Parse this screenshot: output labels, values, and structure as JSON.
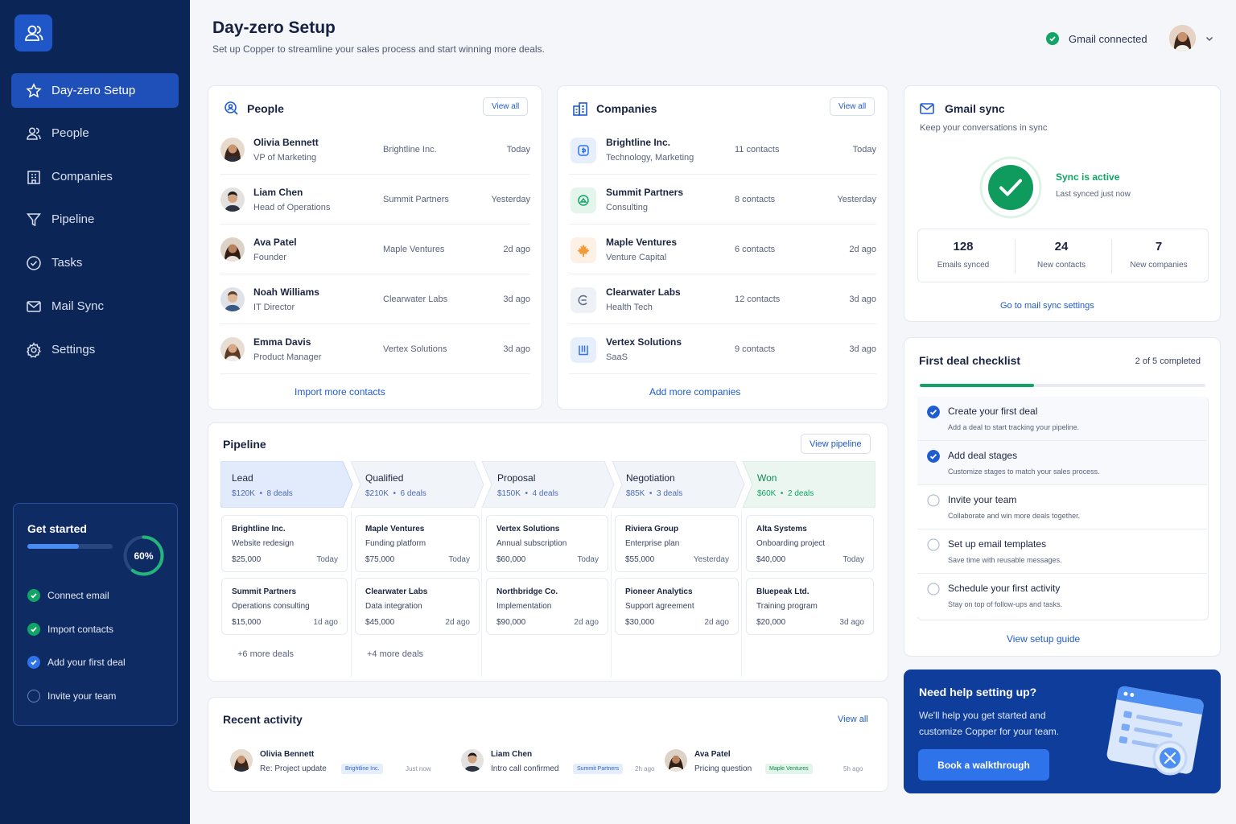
{
  "colors": {
    "sidebar": "#0c2557",
    "accent": "#1f5ccf",
    "success": "#12a464",
    "active_nav": "#1f4fb8"
  },
  "sidebar": {
    "items": [
      {
        "label": "Day-zero Setup",
        "icon": "rocket-icon",
        "active": true
      },
      {
        "label": "People",
        "icon": "people-icon"
      },
      {
        "label": "Companies",
        "icon": "building-icon"
      },
      {
        "label": "Pipeline",
        "icon": "funnel-icon"
      },
      {
        "label": "Tasks",
        "icon": "check-circle-icon"
      },
      {
        "label": "Mail Sync",
        "icon": "mail-icon"
      },
      {
        "label": "Settings",
        "icon": "gear-icon"
      }
    ],
    "get_started": {
      "title": "Get started",
      "progress_percent": 60,
      "progress_label": "60%",
      "items": [
        {
          "label": "Connect email",
          "state": "done"
        },
        {
          "label": "Import contacts",
          "state": "done"
        },
        {
          "label": "Add your first deal",
          "state": "current"
        },
        {
          "label": "Invite your team",
          "state": "todo"
        }
      ]
    }
  },
  "header": {
    "title": "Day-zero Setup",
    "subtitle": "Set up Copper to streamline your sales process and start winning more deals.",
    "gmail_status": "Gmail connected"
  },
  "people": {
    "title": "People",
    "view_all": "View all",
    "rows": [
      {
        "name": "Olivia Bennett",
        "role": "VP of Marketing",
        "company": "Brightline Inc.",
        "time": "Today"
      },
      {
        "name": "Liam Chen",
        "role": "Head of Operations",
        "company": "Summit Partners",
        "time": "Yesterday"
      },
      {
        "name": "Ava Patel",
        "role": "Founder",
        "company": "Maple Ventures",
        "time": "2d ago"
      },
      {
        "name": "Noah Williams",
        "role": "IT Director",
        "company": "Clearwater Labs",
        "time": "3d ago"
      },
      {
        "name": "Emma Davis",
        "role": "Product Manager",
        "company": "Vertex Solutions",
        "time": "3d ago"
      }
    ],
    "footer_link": "Import more contacts"
  },
  "companies": {
    "title": "Companies",
    "view_all": "View all",
    "rows": [
      {
        "name": "Brightline Inc.",
        "industry": "Technology, Marketing",
        "contacts": "11 contacts",
        "time": "Today"
      },
      {
        "name": "Summit Partners",
        "industry": "Consulting",
        "contacts": "8 contacts",
        "time": "Yesterday"
      },
      {
        "name": "Maple Ventures",
        "industry": "Venture Capital",
        "contacts": "6 contacts",
        "time": "2d ago"
      },
      {
        "name": "Clearwater Labs",
        "industry": "Health Tech",
        "contacts": "12 contacts",
        "time": "3d ago"
      },
      {
        "name": "Vertex Solutions",
        "industry": "SaaS",
        "contacts": "9 contacts",
        "time": "3d ago"
      }
    ],
    "footer_link": "Add more companies"
  },
  "gmail_sync": {
    "title": "Gmail sync",
    "subtitle": "Keep your conversations in sync",
    "status": "Sync is active",
    "last_synced": "Last synced just now",
    "stats": [
      {
        "value": "128",
        "label": "Emails synced"
      },
      {
        "value": "24",
        "label": "New contacts"
      },
      {
        "value": "7",
        "label": "New companies"
      }
    ],
    "settings_link": "Go to mail sync settings"
  },
  "pipeline": {
    "title": "Pipeline",
    "view_button": "View pipeline",
    "stages": [
      {
        "name": "Lead",
        "value": "$120K",
        "deals": "8 deals"
      },
      {
        "name": "Qualified",
        "value": "$210K",
        "deals": "6 deals"
      },
      {
        "name": "Proposal",
        "value": "$150K",
        "deals": "4 deals"
      },
      {
        "name": "Negotiation",
        "value": "$85K",
        "deals": "3 deals"
      },
      {
        "name": "Won",
        "value": "$60K",
        "deals": "2 deals"
      }
    ],
    "deals": [
      [
        {
          "company": "Brightline Inc.",
          "desc": "Website redesign",
          "value": "$25,000",
          "time": "Today"
        },
        {
          "company": "Summit Partners",
          "desc": "Operations consulting",
          "value": "$15,000",
          "time": "1d ago"
        }
      ],
      [
        {
          "company": "Maple Ventures",
          "desc": "Funding platform",
          "value": "$75,000",
          "time": "Today"
        },
        {
          "company": "Clearwater Labs",
          "desc": "Data integration",
          "value": "$45,000",
          "time": "2d ago"
        }
      ],
      [
        {
          "company": "Vertex Solutions",
          "desc": "Annual subscription",
          "value": "$60,000",
          "time": "Today"
        },
        {
          "company": "Northbridge Co.",
          "desc": "Implementation",
          "value": "$90,000",
          "time": "2d ago"
        }
      ],
      [
        {
          "company": "Riviera Group",
          "desc": "Enterprise plan",
          "value": "$55,000",
          "time": "Yesterday"
        },
        {
          "company": "Pioneer Analytics",
          "desc": "Support agreement",
          "value": "$30,000",
          "time": "2d ago"
        }
      ],
      [
        {
          "company": "Alta Systems",
          "desc": "Onboarding project",
          "value": "$40,000",
          "time": "Today"
        },
        {
          "company": "Bluepeak Ltd.",
          "desc": "Training program",
          "value": "$20,000",
          "time": "3d ago"
        }
      ]
    ],
    "more": [
      "+6 more deals",
      "+4 more deals"
    ]
  },
  "checklist": {
    "title": "First deal checklist",
    "progress_text": "2 of 5 completed",
    "progress_fraction": 0.4,
    "items": [
      {
        "title": "Create your first deal",
        "desc": "Add a deal to start tracking your pipeline.",
        "done": true
      },
      {
        "title": "Add deal stages",
        "desc": "Customize stages to match your sales process.",
        "done": true
      },
      {
        "title": "Invite your team",
        "desc": "Collaborate and win more deals together.",
        "done": false
      },
      {
        "title": "Set up email templates",
        "desc": "Save time with reusable messages.",
        "done": false
      },
      {
        "title": "Schedule your first activity",
        "desc": "Stay on top of follow-ups and tasks.",
        "done": false
      }
    ],
    "guide_link": "View setup guide"
  },
  "activity": {
    "title": "Recent activity",
    "view_all": "View all",
    "items": [
      {
        "name": "Olivia Bennett",
        "desc": "Re: Project update",
        "tag": "Brightline Inc.",
        "time": "Just now"
      },
      {
        "name": "Liam Chen",
        "desc": "Intro call confirmed",
        "tag": "Summit Partners",
        "time": "2h ago"
      },
      {
        "name": "Ava Patel",
        "desc": "Pricing question",
        "tag": "Maple Ventures",
        "time": "5h ago"
      }
    ]
  },
  "help": {
    "title": "Need help setting up?",
    "desc": "We'll help you get started and customize Copper for your team.",
    "button": "Book a walkthrough"
  }
}
